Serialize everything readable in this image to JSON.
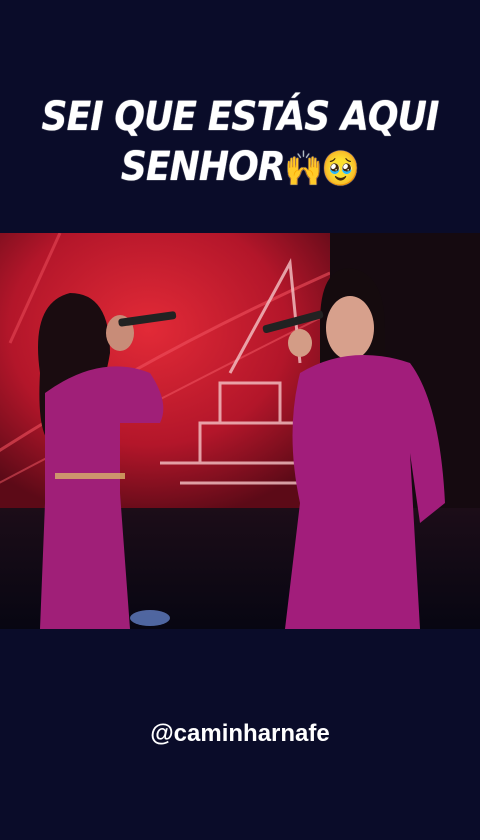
{
  "caption": {
    "line1": "SEI QUE ESTÁS AQUI",
    "line2": "SENHOR",
    "emoji_hands": "🙌",
    "emoji_face": "🥹"
  },
  "video": {
    "scene": "two-singers-on-stage",
    "colors": {
      "screen_red": "#c0182b",
      "outfit_magenta": "#a01f78",
      "background": "#0a0c29"
    }
  },
  "footer": {
    "handle": "@caminharnafe"
  }
}
